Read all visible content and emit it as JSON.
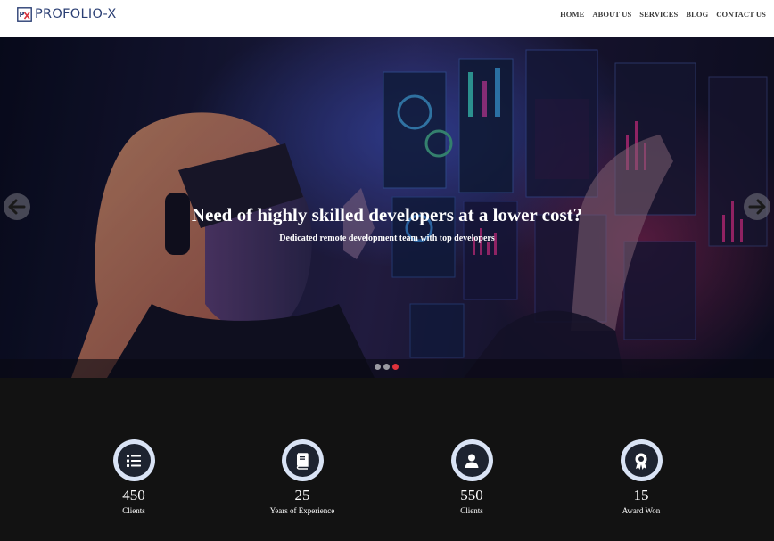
{
  "brand": {
    "name": "PROFOLIO-X",
    "logo_icon": "px-monogram-icon",
    "color": "#2b3f74"
  },
  "nav": {
    "items": [
      {
        "label": "HOME"
      },
      {
        "label": "ABOUT US"
      },
      {
        "label": "SERVICES"
      },
      {
        "label": "BLOG"
      },
      {
        "label": "CONTACT US"
      }
    ]
  },
  "hero": {
    "title": "Need of highly skilled developers at a lower cost?",
    "subtitle": "Dedicated remote development team with top developers",
    "prev_icon": "arrow-left-icon",
    "next_icon": "arrow-right-icon",
    "slides_total": 3,
    "active_slide": 3,
    "active_color": "#e0323c"
  },
  "stats": [
    {
      "number": "450",
      "label": "Clients",
      "icon": "list-icon"
    },
    {
      "number": "25",
      "label": "Years of Experience",
      "icon": "book-icon"
    },
    {
      "number": "550",
      "label": "Clients",
      "icon": "user-icon"
    },
    {
      "number": "15",
      "label": "Award Won",
      "icon": "award-icon"
    }
  ]
}
